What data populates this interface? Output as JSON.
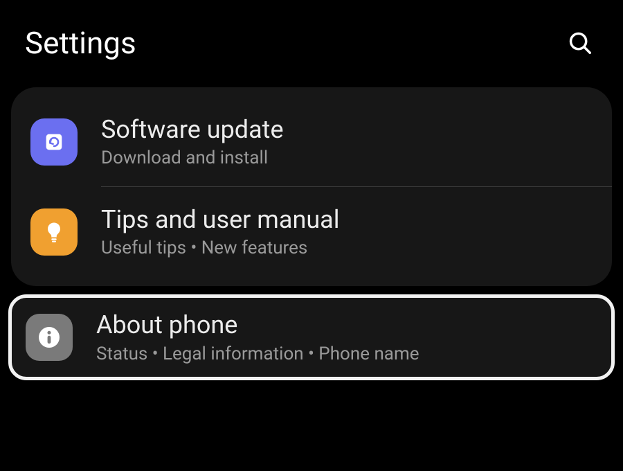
{
  "header": {
    "title": "Settings"
  },
  "items": [
    {
      "title": "Software update",
      "subtitle": "Download and install"
    },
    {
      "title": "Tips and user manual",
      "subtitle": "Useful tips  •  New features"
    },
    {
      "title": "About phone",
      "subtitle": "Status  •  Legal information  •  Phone name"
    }
  ]
}
